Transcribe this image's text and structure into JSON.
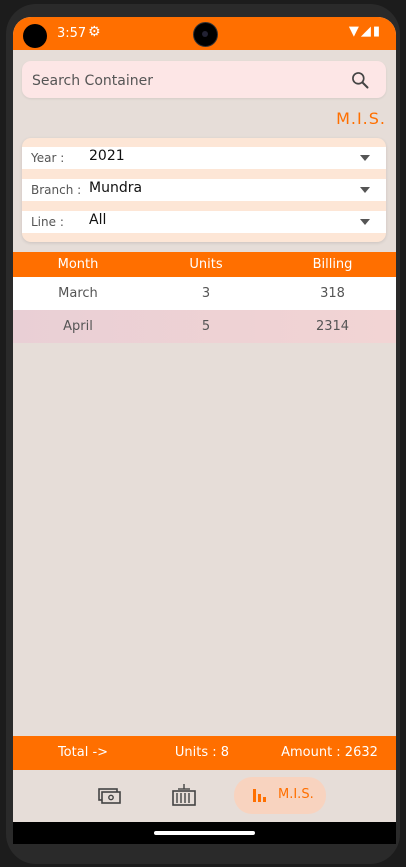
{
  "status": {
    "time": "3:57"
  },
  "search": {
    "placeholder": "Search Container"
  },
  "section_title": "M.I.S.",
  "filters": [
    {
      "label": "Year :",
      "value": "2021"
    },
    {
      "label": "Branch :",
      "value": "Mundra"
    },
    {
      "label": "Line :",
      "value": "All"
    }
  ],
  "table": {
    "headers": [
      "Month",
      "Units",
      "Billing"
    ],
    "rows": [
      [
        "March",
        "3",
        "318"
      ],
      [
        "April",
        "5",
        "2314"
      ]
    ]
  },
  "totals": {
    "label": "Total ->",
    "units": "Units : 8",
    "amount": "Amount : 2632"
  },
  "nav": {
    "items": [
      {
        "icon": "billing-icon"
      },
      {
        "icon": "container-icon"
      },
      {
        "icon": "bar-chart-icon",
        "label": "M.I.S."
      }
    ]
  },
  "colors": {
    "accent": "#ff6f00",
    "background": "#e6ddd8",
    "row_highlight": "#f2d4d4"
  }
}
